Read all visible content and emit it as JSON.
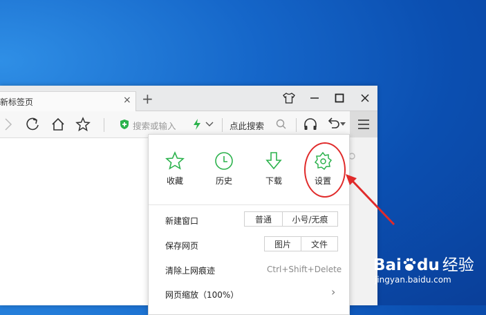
{
  "browser": {
    "tab_title": "新标签页",
    "tab_close": "×",
    "new_tab": "+"
  },
  "toolbar": {
    "search_placeholder": "搜索或输入",
    "search_keyword": "点此搜索"
  },
  "menu": {
    "quick_items": [
      {
        "label": "收藏",
        "icon": "star-icon"
      },
      {
        "label": "历史",
        "icon": "clock-icon"
      },
      {
        "label": "下载",
        "icon": "download-icon"
      },
      {
        "label": "设置",
        "icon": "gear-icon"
      }
    ],
    "new_window": {
      "label": "新建窗口",
      "options": [
        "普通",
        "小号/无痕"
      ]
    },
    "save_page": {
      "label": "保存网页",
      "options": [
        "图片",
        "文件"
      ]
    },
    "clear_traces": {
      "label": "清除上网痕迹",
      "shortcut": "Ctrl+Shift+Delete"
    },
    "zoom": {
      "label": "网页缩放（100%）",
      "chevron": "›"
    }
  },
  "watermark": {
    "logo": "Bai",
    "logo_tail": "du",
    "jingyan": "经验",
    "url": "jingyan.baidu.com"
  },
  "colors": {
    "accent_green": "#2bb24c",
    "annotation_red": "#e02a2a",
    "desktop_blue": "#1566c9"
  }
}
